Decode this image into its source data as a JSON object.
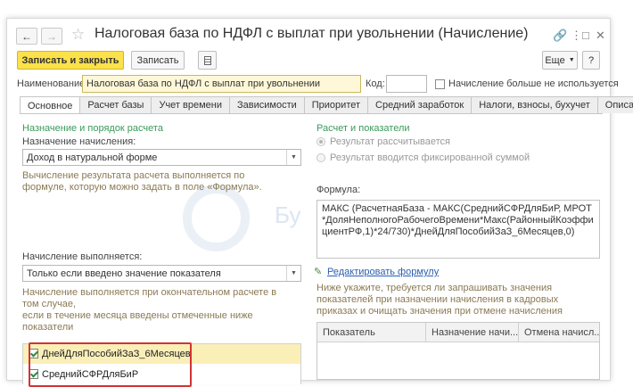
{
  "window": {
    "title": "Налоговая база по НДФЛ с выплат при увольнении (Начисление)",
    "back_icon": "arrow-left",
    "forward_icon": "arrow-right",
    "star_icon": "star-outline",
    "link_icon": "link",
    "more_icon": "more-vertical",
    "maximize_icon": "maximize",
    "close_icon": "close"
  },
  "toolbar": {
    "save_close_label": "Записать и закрыть",
    "save_label": "Записать",
    "more_label": "Еще",
    "help_label": "?"
  },
  "header": {
    "name_label": "Наименование:",
    "name_value": "Налоговая база по НДФЛ с выплат при увольнении",
    "code_label": "Код:",
    "code_value": "",
    "unused_label": "Начисление больше не используется"
  },
  "tabs": [
    {
      "label": "Основное"
    },
    {
      "label": "Расчет базы"
    },
    {
      "label": "Учет времени"
    },
    {
      "label": "Зависимости"
    },
    {
      "label": "Приоритет"
    },
    {
      "label": "Средний заработок"
    },
    {
      "label": "Налоги, взносы, бухучет"
    },
    {
      "label": "Описание"
    }
  ],
  "left": {
    "section_title": "Назначение и порядок расчета",
    "purpose_label": "Назначение начисления:",
    "purpose_value": "Доход в натуральной форме",
    "purpose_hint": "Вычисление результата расчета выполняется по формуле, которую можно задать в поле «Формула».",
    "exec_label": "Начисление выполняется:",
    "exec_value": "Только если введено значение показателя",
    "exec_hint_1": "Начисление выполняется при окончательном расчете в том случае,",
    "exec_hint_2": "если в течение месяца введены отмеченные ниже показатели",
    "indicators": [
      {
        "label": "ДнейДляПособийЗаЗ_6Месяцев",
        "checked": true
      },
      {
        "label": "СреднийСФРДляБиР",
        "checked": true
      }
    ]
  },
  "right": {
    "section_title": "Расчет и показатели",
    "radio_calculated": "Результат рассчитывается",
    "radio_fixed": "Результат вводится фиксированной суммой",
    "formula_label": "Формула:",
    "formula_text": "МАКС (РасчетнаяБаза - МАКС(СреднийСФРДляБиР, МРОТ*ДоляНеполногоРабочегоВремени*Макс(РайонныйКоэффициентРФ,1)*24/730)*ДнейДляПособийЗаЗ_6Месяцев,0)",
    "edit_formula_link": "Редактировать формулу",
    "edit_icon": "pencil",
    "indicators_hint": "Ниже укажите, требуется ли запрашивать значения показателей при назначении начисления в кадровых приказах и очищать значения при отмене начисления",
    "table_headers": [
      "Показатель",
      "Назначение начи...",
      "Отмена начисл..."
    ]
  },
  "watermark_text": "Бу"
}
